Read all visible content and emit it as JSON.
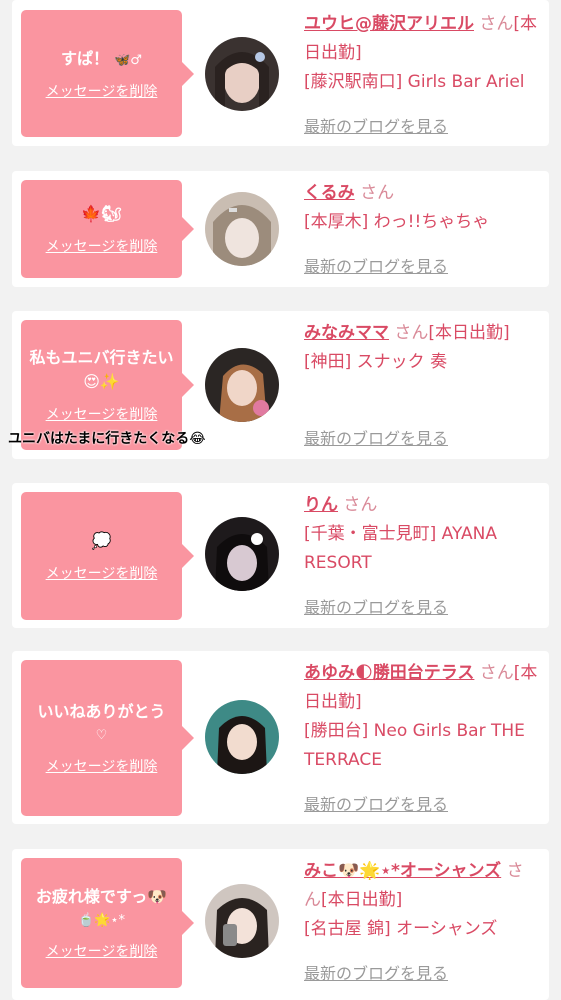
{
  "common": {
    "delete_label": "メッセージを削除",
    "blog_label": "最新のブログを見る",
    "san": "さん"
  },
  "colors": {
    "bubble": "#fa95a0",
    "name": "#d94a64",
    "link_gray": "#9a9a9a",
    "background": "#f2f2f2"
  },
  "cards": [
    {
      "message": "すぱ！",
      "message_emoji": "🦋♂",
      "name": "ユウヒ@藤沢アリエル",
      "status": "[本日出勤]",
      "shop": "[藤沢駅南口] Girls Bar Ariel"
    },
    {
      "message": "🍁🐿",
      "message_emoji": "",
      "name": "くるみ",
      "status": "",
      "shop": "[本厚木] わっ!!ちゃちゃ"
    },
    {
      "message": "私もユニバ行きたい😍✨",
      "message_emoji": "",
      "name": "みなみママ",
      "status": "[本日出勤]",
      "shop": "[神田] スナック 奏"
    },
    {
      "message": "💭",
      "message_emoji": "",
      "name": "りん",
      "status": "",
      "shop": "[千葉・富士見町] AYANA RESORT"
    },
    {
      "message": "いいねありがとう",
      "message_emoji": "♡",
      "name": "あゆみ🌓勝田台テラス",
      "status": "[本日出勤]",
      "shop": "[勝田台] Neo Girls Bar THE TERRACE"
    },
    {
      "message": "お疲れ様ですっ🐶",
      "message_emoji": "🍵🌟⋆*",
      "name": "みこ🐶🌟⋆*オーシャンズ",
      "status": "[本日出勤]",
      "shop": "[名古屋 錦] オーシャンズ"
    }
  ],
  "overlay_text": "ユニバはたまに行きたくなる😂"
}
